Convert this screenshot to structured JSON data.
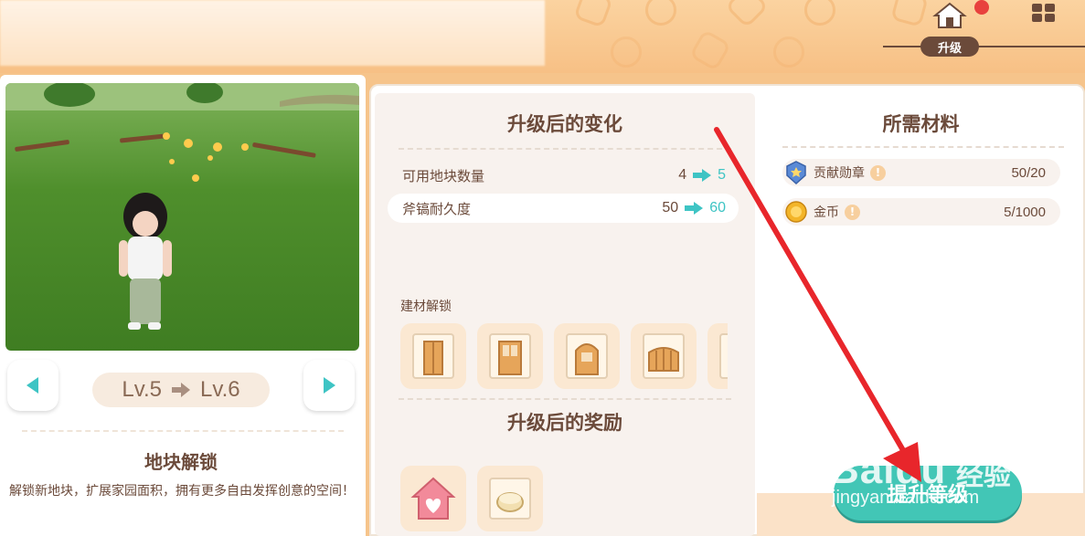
{
  "header": {
    "active_tab": "升级"
  },
  "left": {
    "level_from": "Lv.5",
    "level_to": "Lv.6",
    "unlock_title": "地块解锁",
    "unlock_desc": "解锁新地块，扩展家园面积，拥有更多自由发挥创意的空间！"
  },
  "changes": {
    "title": "升级后的变化",
    "stats": [
      {
        "label": "可用地块数量",
        "from": "4",
        "to": "5"
      },
      {
        "label": "斧镐耐久度",
        "from": "50",
        "to": "60"
      }
    ],
    "materials_label": "建材解锁",
    "reward_title": "升级后的奖励"
  },
  "requirements": {
    "title": "所需材料",
    "items": [
      {
        "name": "贡献勋章",
        "icon": "medal-icon",
        "qty": "50/20"
      },
      {
        "name": "金币",
        "icon": "coin-icon",
        "qty": "5/1000"
      }
    ]
  },
  "actions": {
    "upgrade_label": "提升等级"
  },
  "watermark": {
    "brand": "Baidu",
    "brand_cn": "经验",
    "url": "jingyan.baidu.com"
  },
  "colors": {
    "accent_teal": "#42c6b6",
    "brown_text": "#6b4a3a",
    "annotation_red": "#e8262b",
    "notification_red": "#e8413e"
  }
}
